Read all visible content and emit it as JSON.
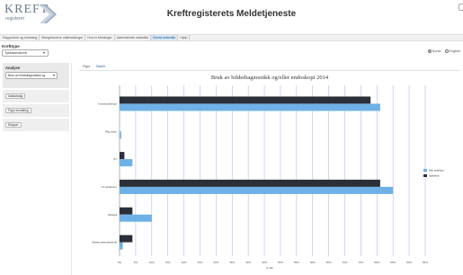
{
  "header": {
    "logo_text": "KREFT",
    "logo_sub": "registeret",
    "title": "Kreftregisterets Meldetjeneste"
  },
  "nav": {
    "tabs": [
      {
        "label": "Rapportere og Innlesing",
        "active": false
      },
      {
        "label": "Mangelskreve mål/meldinger",
        "active": false
      },
      {
        "label": "Hva er Meldinger",
        "active": false
      },
      {
        "label": "Administrativ statistikk",
        "active": false
      },
      {
        "label": "Klinisk statistikk",
        "active": true
      },
      {
        "label": "Hjelp",
        "active": false
      }
    ]
  },
  "kreft": {
    "label": "Krefttype",
    "selected": "Tykktarmskreft"
  },
  "language": {
    "norsk": "Norsk",
    "english": "English",
    "selected": "norsk"
  },
  "sidebar": {
    "analyse_label": "Analyse",
    "analyse_selected": "Bruk av bildediagnostikk og",
    "buttons": [
      "Datautvalg",
      "Figur innstilling",
      "Eksport"
    ]
  },
  "tabs": {
    "figure": "Figur",
    "table": "Tabell"
  },
  "colors": {
    "series_dark": "#2b2f38",
    "series_light": "#6fb1e6",
    "gridline": "#b9b7e3",
    "accent_link": "#1a5c96"
  },
  "chart_data": {
    "type": "bar",
    "orientation": "horizontal",
    "title": "Bruk av bildediagnostikk og/eller endoskopi 2014",
    "categories": [
      "Koloskopi/skopi",
      "Rtg.colon",
      "CT",
      "CT-abdomen",
      "Ultralyd",
      "Radionukleotidteknik"
    ],
    "series": [
      {
        "name": "Alle sykehus",
        "color": "#6fb1e6",
        "values": [
          81,
          0.5,
          4,
          85,
          10,
          1
        ]
      },
      {
        "name": "Sykehus",
        "color": "#2b2f38",
        "values": [
          78,
          0,
          1.5,
          81,
          4,
          4
        ]
      }
    ],
    "xlim": [
      0,
      95
    ],
    "xticks": [
      "0%",
      "5%",
      "10%",
      "15%",
      "20%",
      "25%",
      "30%",
      "35%",
      "40%",
      "45%",
      "50%",
      "55%",
      "60%",
      "65%",
      "70%",
      "75%",
      "80%",
      "85%",
      "90%",
      "95%"
    ],
    "xlabel": "Andel",
    "legend_position": "right",
    "grid": true
  }
}
